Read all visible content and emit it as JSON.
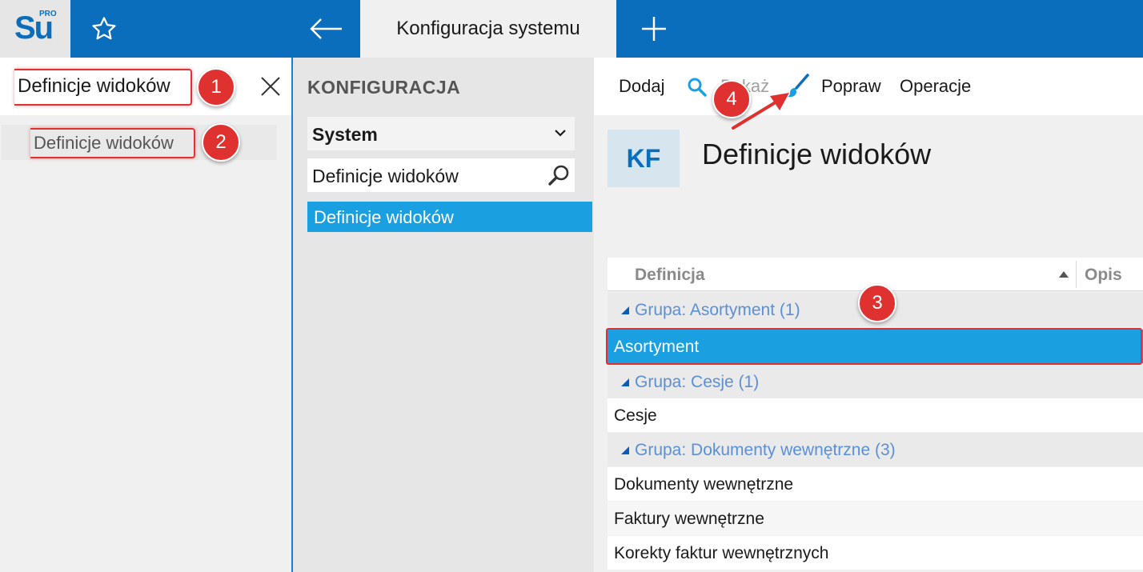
{
  "app": {
    "logo_text": "Su",
    "logo_sup": "PRO",
    "tab_title": "Konfiguracja systemu"
  },
  "search": {
    "query": "Definicje widoków",
    "results": [
      {
        "label": "Definicje widoków"
      }
    ]
  },
  "config": {
    "title": "KONFIGURACJA",
    "select_value": "System",
    "filter_value": "Definicje widoków",
    "items": [
      {
        "label": "Definicje widoków"
      }
    ]
  },
  "toolbar": {
    "add_label": "Dodaj",
    "show_label": "Pokaż",
    "edit_label": "Popraw",
    "operations_label": "Operacje"
  },
  "page": {
    "badge": "KF",
    "title": "Definicje widoków"
  },
  "grid": {
    "columns": [
      "Definicja",
      "Opis"
    ],
    "rows": [
      {
        "type": "group",
        "label": "Grupa: Asortyment (1)"
      },
      {
        "type": "item",
        "label": "Asortyment",
        "selected": true
      },
      {
        "type": "group",
        "label": "Grupa: Cesje (1)"
      },
      {
        "type": "item",
        "label": "Cesje"
      },
      {
        "type": "group",
        "label": "Grupa: Dokumenty wewnętrzne (3)"
      },
      {
        "type": "item",
        "label": "Dokumenty wewnętrzne"
      },
      {
        "type": "item",
        "label": "Faktury wewnętrzne"
      },
      {
        "type": "item",
        "label": "Korekty faktur wewnętrznych"
      }
    ]
  },
  "annotations": {
    "m1": "1",
    "m2": "2",
    "m3": "3",
    "m4": "4"
  },
  "colors": {
    "brand": "#0a6ebd",
    "selection": "#1a9fe0",
    "group_text": "#5b8fd6",
    "marker": "#e03131"
  }
}
